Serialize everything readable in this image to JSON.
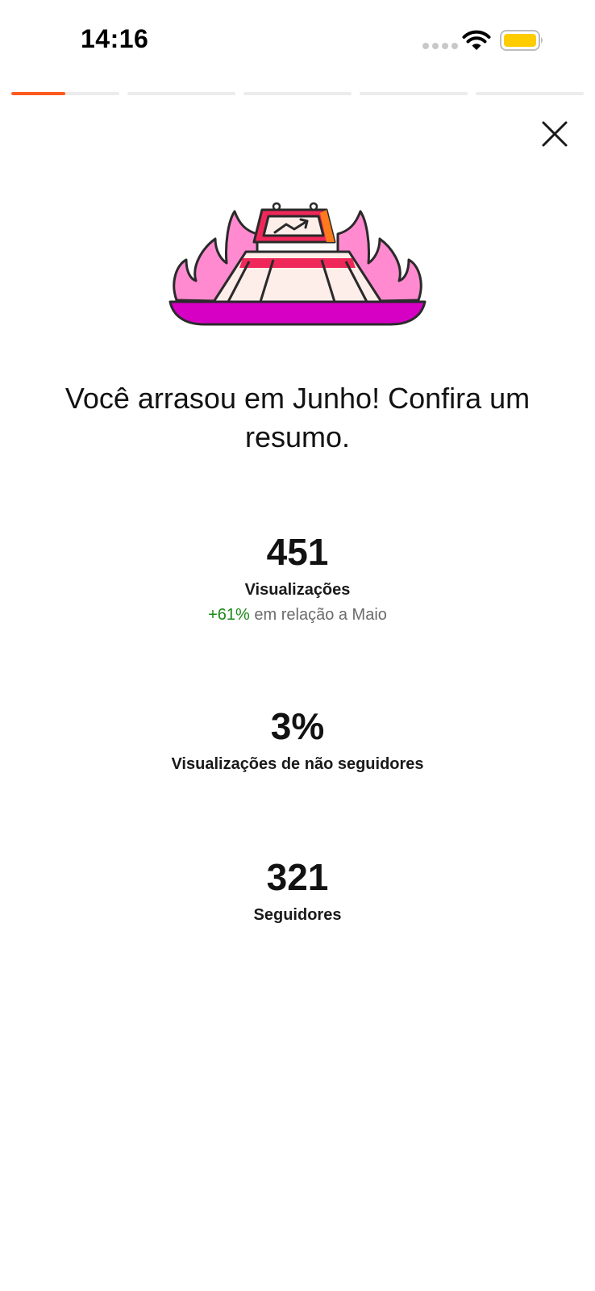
{
  "status_bar": {
    "time": "14:16",
    "icons": [
      "signal-icon",
      "wifi-icon",
      "battery-icon"
    ],
    "battery_color": "#FFCC00"
  },
  "story": {
    "segments": 5,
    "current_index": 0,
    "current_progress": 0.5,
    "progress_color": "#FF5A1F"
  },
  "header": {
    "close_icon": "close-icon"
  },
  "illustration": {
    "icon": "stadium-trending-chart-illustration",
    "colors": {
      "flames": "#FF8AD0",
      "base": "#D600C4",
      "accent_red": "#F0285A",
      "accent_orange": "#FF7A1A",
      "cream": "#FDEEEA"
    }
  },
  "main": {
    "headline": "Você arrasou em Junho! Confira um resumo.",
    "stats": [
      {
        "value": "451",
        "label": "Visualizações",
        "delta": "+61%",
        "comparison": "em relação a Maio"
      },
      {
        "value": "3%",
        "label": "Visualizações de não seguidores"
      },
      {
        "value": "321",
        "label": "Seguidores"
      }
    ]
  },
  "colors": {
    "positive": "#1A8917",
    "text": "#121212",
    "muted": "#6B6B6B"
  }
}
